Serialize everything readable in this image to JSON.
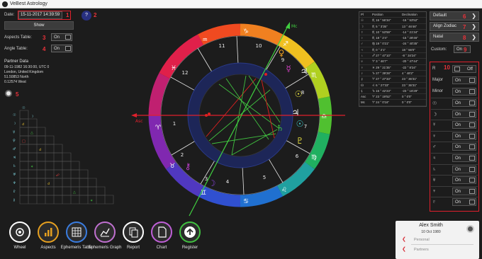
{
  "app": {
    "title": "VeBest Astrology"
  },
  "left_panel": {
    "date_label": "Date:",
    "date_value": "15-11-2017 14:39:59",
    "help_label": "?",
    "show_button": "Show",
    "aspects_table_label": "Aspects Table:",
    "aspects_table_toggle": "On",
    "angle_table_label": "Angle Table:",
    "angle_table_toggle": "On"
  },
  "partner": {
    "heading": "Partner Data",
    "datetime": "09-11-1982 16:30:00, UTC 0",
    "location": "London, United Kingdom",
    "latitude": "51.50853 North",
    "longitude": "0.12574 West"
  },
  "callouts": [
    "1",
    "2",
    "3",
    "4",
    "5",
    "6",
    "7",
    "8",
    "9",
    "10"
  ],
  "chart": {
    "house_numbers": [
      "1",
      "2",
      "3",
      "4",
      "5",
      "6",
      "7",
      "8",
      "9",
      "10",
      "11",
      "12"
    ],
    "asc_label": "Asc",
    "mc_label": "Mc"
  },
  "ephemeris": {
    "headers": [
      "Pl",
      "Position",
      "Declination"
    ],
    "rows": [
      [
        "☉",
        "♏ 16 ° 56'34\"",
        "-16 ° 53'52\""
      ],
      [
        "☽",
        "♏ 5 ° 3'35\"",
        "13 ° 46'46\""
      ],
      [
        "☿",
        "♏ 10 ° 53'59\"",
        "-14 ° 21'34\""
      ],
      [
        "♀",
        "♏ 18 ° 2'4\"",
        "-15 ° 28'46\""
      ],
      [
        "♂",
        "♍ 19 ° 0'21\"",
        "-24 ° 40'35\""
      ],
      [
        "♃",
        "♏ 0 ° 2'1\"",
        "18 ° 56'0\""
      ],
      [
        "♄",
        "♐ 27 ° 47'10\"",
        "-8 ° 34'24\""
      ],
      [
        "♅",
        "♈ 3 ° 46'7\"",
        "-20 ° 47'44\""
      ],
      [
        "♆",
        "♓ 29 ° 21'35\"",
        "-22 ° 8'24\""
      ],
      [
        "♇",
        "♑ 27 ° 39'28\"",
        "4 ° 48'2\""
      ],
      [
        "⚷",
        "♈ 27 ° 27'33\"",
        "23 ° 36'31\""
      ],
      [
        "☊",
        "♌ 6 ° 27'33\"",
        "23 ° 36'31\""
      ],
      [
        "⚸",
        "♑ 15 ° 42'23\"",
        "-23 ° 16'29\""
      ],
      [
        "Asc",
        "♈ 23 ° 19'52\"",
        "0 ° 0'0\""
      ],
      [
        "Mc",
        "♈ 24 ° 0'16\"",
        "0 ° 0'0\""
      ]
    ]
  },
  "right_panel": {
    "default_btn": "Default",
    "align_btn": "Align Zodiac",
    "natal_btn": "Natal",
    "custom_label": "Custom:",
    "custom_toggle": "On",
    "chevron": "❯",
    "r_label": "R",
    "r_toggle": "Off",
    "major_label": "Major",
    "major_toggle": "On",
    "minor_label": "Minor",
    "minor_toggle": "On",
    "planet_toggles": [
      {
        "glyph": "☉",
        "toggle": "On"
      },
      {
        "glyph": "☽",
        "toggle": "On"
      },
      {
        "glyph": "☿",
        "toggle": "On"
      },
      {
        "glyph": "♀",
        "toggle": "On"
      },
      {
        "glyph": "♂",
        "toggle": "On"
      },
      {
        "glyph": "♃",
        "toggle": "On"
      },
      {
        "glyph": "♄",
        "toggle": "On"
      },
      {
        "glyph": "♅",
        "toggle": "On"
      },
      {
        "glyph": "♆",
        "toggle": "On"
      },
      {
        "glyph": "♇",
        "toggle": "On"
      }
    ]
  },
  "nav": [
    {
      "label": "Wheel",
      "color": "#ffffff",
      "icon": "target-icon"
    },
    {
      "label": "Aspects",
      "color": "#e6a020",
      "icon": "bar-chart-icon"
    },
    {
      "label": "Ephemeris Table",
      "color": "#3a7de0",
      "icon": "grid-icon"
    },
    {
      "label": "Ephemeris Graph",
      "color": "#c070d0",
      "icon": "line-chart-icon"
    },
    {
      "label": "Report",
      "color": "#ffffff",
      "icon": "copy-icon"
    },
    {
      "label": "Chart",
      "color": "#c060d8",
      "icon": "document-icon"
    },
    {
      "label": "Register",
      "color": "#40c040",
      "icon": "upload-arrow-icon"
    }
  ],
  "profile": {
    "name": "Alex Smith",
    "date": "10 Oct 1980",
    "personal": "Personal",
    "partners": "Partners",
    "chevron": "❮"
  },
  "colors": {
    "accent_red": "#e0202c",
    "background": "#1c1c1c"
  }
}
